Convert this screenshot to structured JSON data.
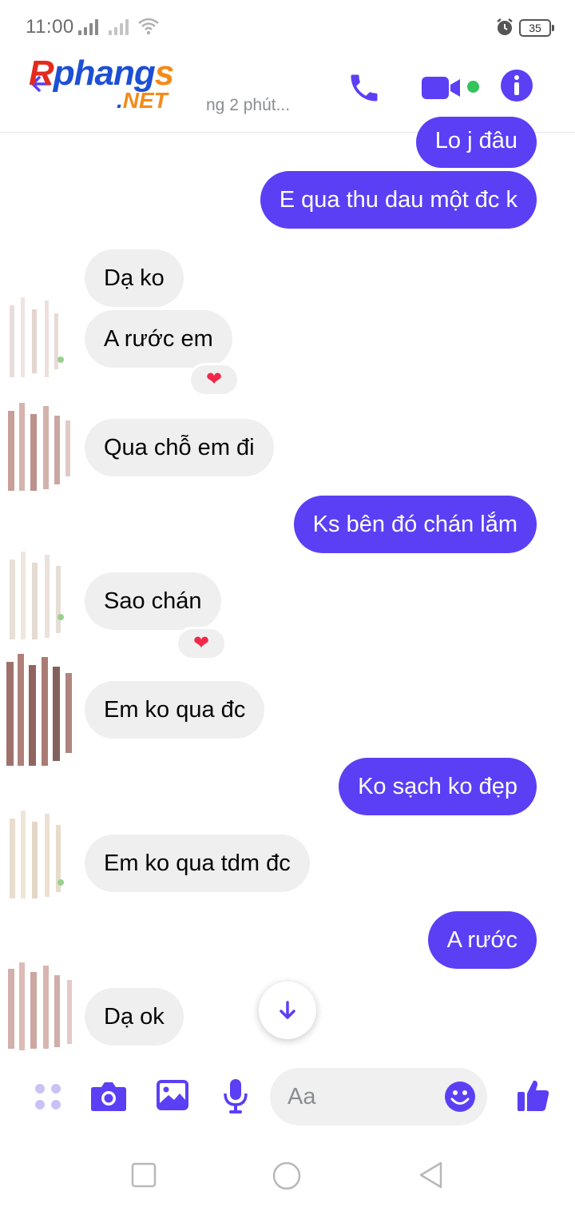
{
  "status_bar": {
    "time": "11:00",
    "battery_level": "35"
  },
  "header": {
    "logo_main_r": "R",
    "logo_main_rest": "phang",
    "logo_main_s": "s",
    "logo_sub_dot": ".",
    "logo_sub": "NET",
    "active_status": "ng 2 phút...",
    "accent_color": "#5b3ff5",
    "online_color": "#31c45a"
  },
  "messages": [
    {
      "side": "sent",
      "text": "Lo j đâu"
    },
    {
      "side": "sent",
      "text": "E qua thu dau một đc k"
    },
    {
      "side": "recv",
      "text": "Dạ ko"
    },
    {
      "side": "recv",
      "text": "A rước em",
      "reaction": "❤"
    },
    {
      "side": "recv",
      "text": "Qua chỗ em đi"
    },
    {
      "side": "sent",
      "text": "Ks bên đó chán lắm"
    },
    {
      "side": "recv",
      "text": "Sao chán",
      "reaction": "❤"
    },
    {
      "side": "recv",
      "text": "Em ko qua đc"
    },
    {
      "side": "sent",
      "text": "Ko sạch ko đẹp"
    },
    {
      "side": "recv",
      "text": "Em ko qua tdm đc"
    },
    {
      "side": "sent",
      "text": "A rước"
    },
    {
      "side": "recv",
      "text": "Dạ ok"
    }
  ],
  "composer": {
    "placeholder": "Aa",
    "icons": [
      "apps-icon",
      "camera-icon",
      "gallery-icon",
      "mic-icon",
      "emoji-icon",
      "like-icon"
    ]
  },
  "nav": {
    "icons": [
      "recent-apps-icon",
      "home-icon",
      "back-icon"
    ]
  }
}
